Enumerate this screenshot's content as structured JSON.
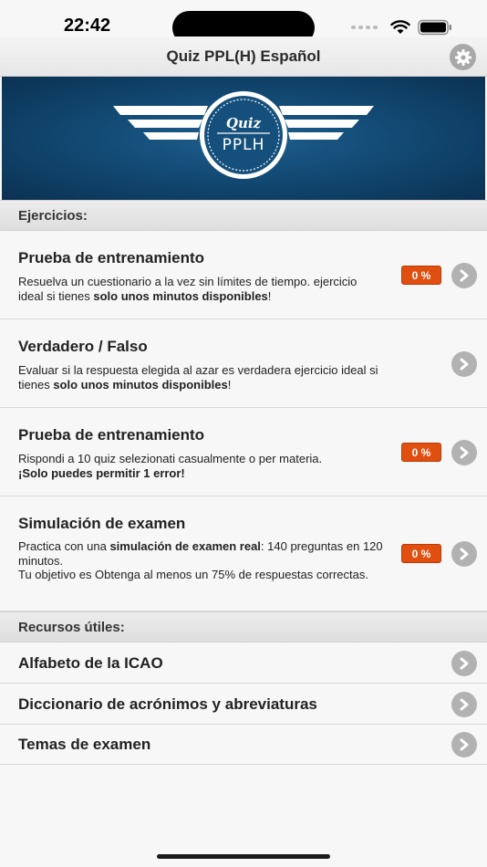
{
  "status_bar": {
    "time": "22:42"
  },
  "nav": {
    "title": "Quiz PPL(H) Español",
    "settings_icon": "gear-icon"
  },
  "banner": {
    "logo_top": "Quiz",
    "logo_bottom": "PPLH"
  },
  "exercises": {
    "header": "Ejercicios:",
    "items": [
      {
        "title": "Prueba de entrenamiento",
        "desc_plain": "Resuelva un cuestionario a la vez sin límites de tiempo. ejercicio ideal si tienes ",
        "desc_bold": "solo unos minutos disponibles",
        "desc_end": "!",
        "badge": "0 %"
      },
      {
        "title": "Verdadero / Falso",
        "desc_plain": "Evaluar si la respuesta elegida al azar es verdadera ejercicio ideal si tienes ",
        "desc_bold": "solo unos minutos disponibles",
        "desc_end": "!"
      },
      {
        "title": "Prueba de entrenamiento",
        "desc_plain": "Rispondi a 10 quiz selezionati casualmente o per materia.",
        "desc_bold": "¡Solo puedes permitir 1 error!",
        "badge": "0 %"
      },
      {
        "title": "Simulación de examen",
        "desc_pre": "Practica con una ",
        "desc_bold": "simulación de examen real",
        "desc_post": ": 140 preguntas en 120 minutos.",
        "desc_line2": "Tu objetivo es Obtenga al menos un 75% de respuestas correctas.",
        "badge": "0 %"
      }
    ]
  },
  "resources": {
    "header": "Recursos útiles:",
    "items": [
      {
        "title": "Alfabeto de la ICAO"
      },
      {
        "title": "Diccionario de acrónimos y abreviaturas"
      },
      {
        "title": "Temas de examen"
      }
    ]
  },
  "colors": {
    "badge": "#e04e10",
    "banner": "#124a74"
  }
}
